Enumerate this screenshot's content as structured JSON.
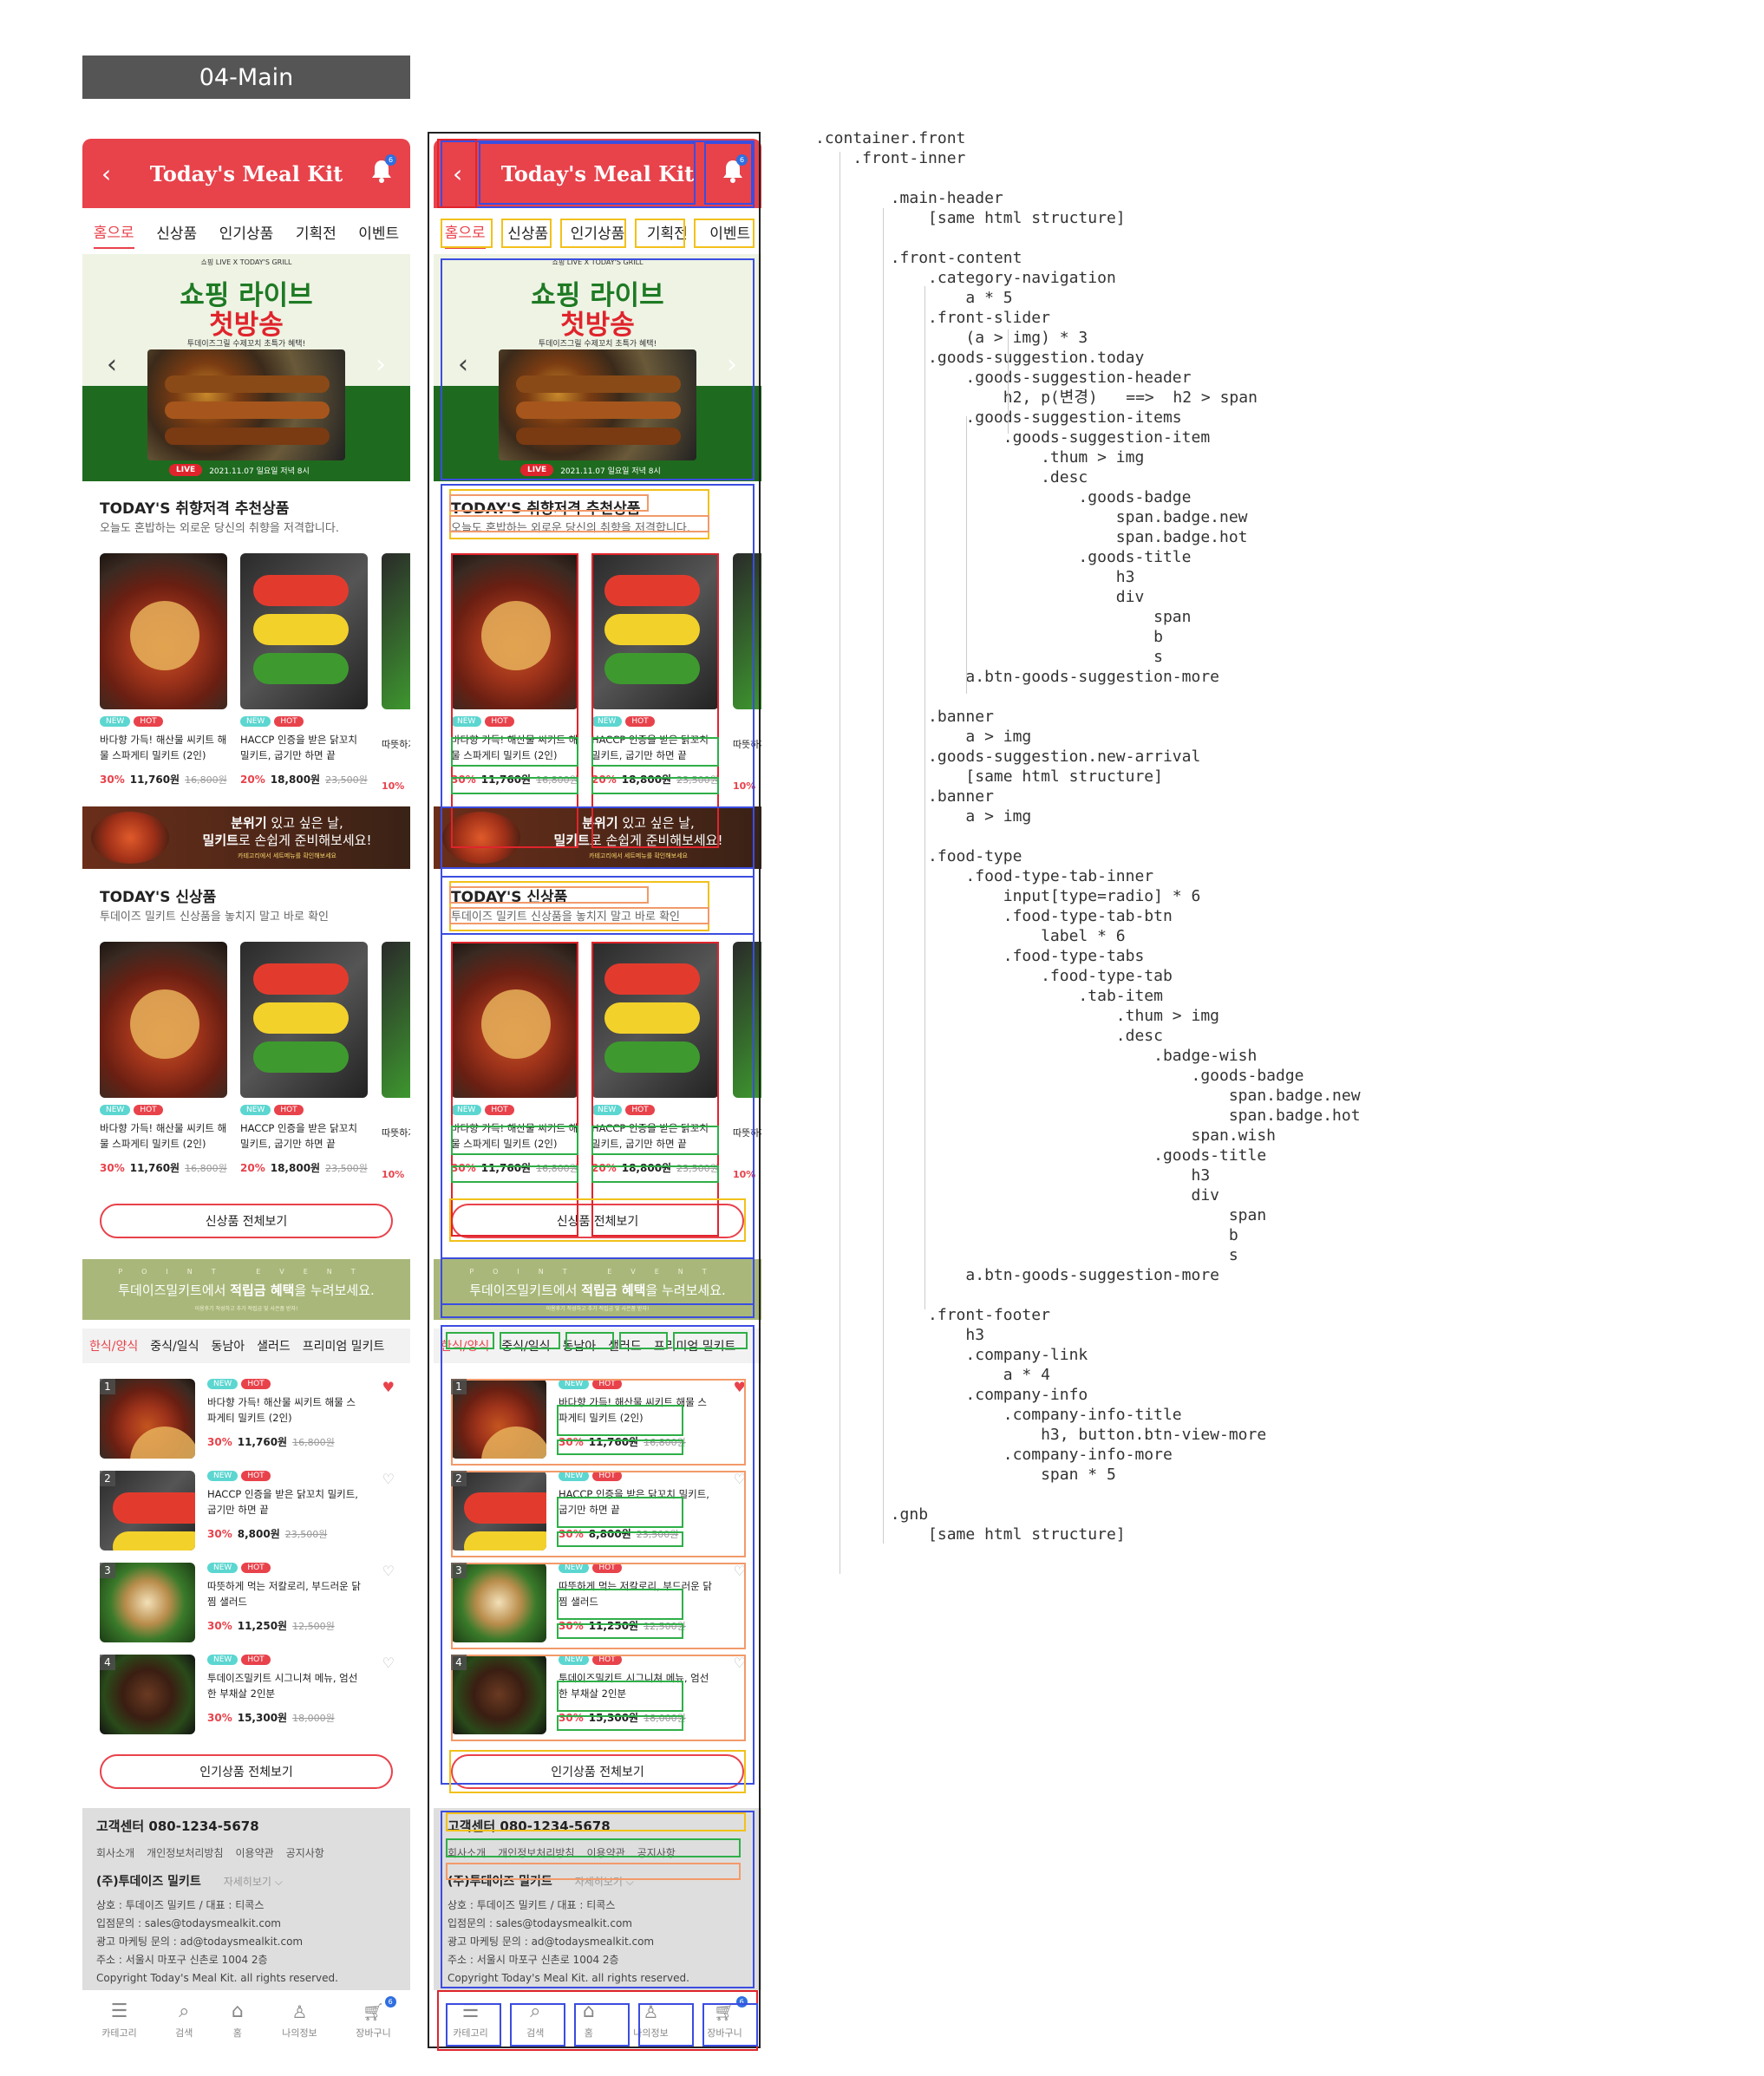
{
  "page_label": "04-Main",
  "header": {
    "back_icon": "chevron-left-icon",
    "title": "Today's Meal Kit",
    "bell_icon": "bell-icon",
    "bell_count": "6"
  },
  "category_nav": [
    "홈으로",
    "신상품",
    "인기상품",
    "기획전",
    "이벤트"
  ],
  "slider": {
    "kicker": "쇼핑 LIVE X TODAY'S GRILL",
    "headline1": "쇼핑 라이브",
    "headline2": "첫방송",
    "sub": "투데이즈그릴 수제꼬치 초특가 혜택!",
    "live_badge": "LIVE",
    "live_date": "2021.11.07 일요일 저녁 8시"
  },
  "today": {
    "title": "TODAY'S 취향저격 추천상품",
    "subtitle": "오늘도 혼밥하는 외로운 당신의 취향을 저격합니다.",
    "items": [
      {
        "name": "바다향 가득! 해산물 씨키트 해물 스파게티 밀키트 (2인)",
        "discount": "30%",
        "price": "11,760원",
        "original": "16,800원"
      },
      {
        "name": "HACCP 인증을 받은 닭꼬치 밀키트, 굽기만 하면 끝",
        "discount": "20%",
        "price": "18,800원",
        "original": "23,500원"
      }
    ],
    "peek_name": "따뜻하게 드러운",
    "peek_discount": "10%"
  },
  "badges": {
    "new": "NEW",
    "hot": "HOT"
  },
  "banner1": {
    "line1_bold": "분위기",
    "line1_rest": " 있고 싶은 날,",
    "line2_bold": "밀키트",
    "line2_rest": "로 손쉽게 준비해보세요!",
    "small": "카테고리에서 세트메뉴를 확인해보세요"
  },
  "new_arrival": {
    "title": "TODAY'S 신상품",
    "subtitle": "투데이즈 밀키트 신상품을 놓치지 말고 바로 확인",
    "more": "신상품 전체보기"
  },
  "banner2": {
    "kicker": "POINT EVENT",
    "main_pre": "투데이즈밀키트에서 ",
    "main_bold": "적립금 혜택",
    "main_post": "을 누려보세요.",
    "small": "이용후기 작성하고 추가 적립금 및 사은품 받자!"
  },
  "food_tabs": [
    "한식/양식",
    "중식/일식",
    "동남아",
    "샐러드",
    "프리미엄 밀키트"
  ],
  "food_items": [
    {
      "rank": "1",
      "name": "바다향 가득! 해산물 씨키트 해물 스파게티 밀키트 (2인)",
      "discount": "30%",
      "price": "11,760원",
      "original": "16,800원",
      "wish": true
    },
    {
      "rank": "2",
      "name": "HACCP 인증을 받은 닭꼬치 밀키트, 굽기만 하면 끝",
      "discount": "30%",
      "price": "8,800원",
      "original": "23,500원",
      "wish": false
    },
    {
      "rank": "3",
      "name": "따뜻하게 먹는 저칼로리, 부드러운 닭 찜 샐러드",
      "discount": "30%",
      "price": "11,250원",
      "original": "12,500원",
      "wish": false
    },
    {
      "rank": "4",
      "name": "투데이즈밀키트 시그니쳐 메뉴, 엄선한 부채살 2인분",
      "discount": "30%",
      "price": "15,300원",
      "original": "18,000원",
      "wish": false
    }
  ],
  "popular_more": "인기상품 전체보기",
  "footer": {
    "cs": "고객센터  080-1234-5678",
    "links": [
      "회사소개",
      "개인정보처리방침",
      "이용약관",
      "공지사항"
    ],
    "company": "(주)투데이즈 밀키트",
    "view_more": "자세히보기 ⌵",
    "info": [
      "상호 : 투데이즈 밀키트 / 대표 : 티콕스",
      "입점문의 : sales@todaysmealkit.com",
      "광고 마케팅 문의 : ad@todaysmealkit.com",
      "주소 : 서울시 마포구 신촌로 1004 2층",
      "Copyright Today's Meal Kit. all rights reserved."
    ]
  },
  "gnb": [
    {
      "label": "카테고리",
      "icon": "menu-icon"
    },
    {
      "label": "검색",
      "icon": "search-icon"
    },
    {
      "label": "홈",
      "icon": "home-icon"
    },
    {
      "label": "나의정보",
      "icon": "user-icon"
    },
    {
      "label": "장바구니",
      "icon": "cart-icon",
      "count": "6"
    }
  ],
  "code_tree": [
    ".container.front",
    "    .front-inner",
    "",
    "        .main-header",
    "            [same html structure]",
    "",
    "        .front-content",
    "            .category-navigation",
    "                a * 5",
    "            .front-slider",
    "                (a > img) * 3",
    "            .goods-suggestion.today",
    "                .goods-suggestion-header",
    "                    h2, p(변경)   ==>  h2 > span",
    "                .goods-suggestion-items",
    "                    .goods-suggestion-item",
    "                        .thum > img",
    "                        .desc",
    "                            .goods-badge",
    "                                span.badge.new",
    "                                span.badge.hot",
    "                            .goods-title",
    "                                h3",
    "                                div",
    "                                    span",
    "                                    b",
    "                                    s",
    "                a.btn-goods-suggestion-more",
    "",
    "            .banner",
    "                a > img",
    "            .goods-suggestion.new-arrival",
    "                [same html structure]",
    "            .banner",
    "                a > img",
    "",
    "            .food-type",
    "                .food-type-tab-inner",
    "                    input[type=radio] * 6",
    "                    .food-type-tab-btn",
    "                        label * 6",
    "                    .food-type-tabs",
    "                        .food-type-tab",
    "                            .tab-item",
    "                                .thum > img",
    "                                .desc",
    "                                    .badge-wish",
    "                                        .goods-badge",
    "                                            span.badge.new",
    "                                            span.badge.hot",
    "                                        span.wish",
    "                                    .goods-title",
    "                                        h3",
    "                                        div",
    "                                            span",
    "                                            b",
    "                                            s",
    "                a.btn-goods-suggestion-more",
    "",
    "            .front-footer",
    "                h3",
    "                .company-link",
    "                    a * 4",
    "                .company-info",
    "                    .company-info-title",
    "                        h3, button.btn-view-more",
    "                    .company-info-more",
    "                        span * 5",
    "",
    "        .gnb",
    "            [same html structure]"
  ]
}
